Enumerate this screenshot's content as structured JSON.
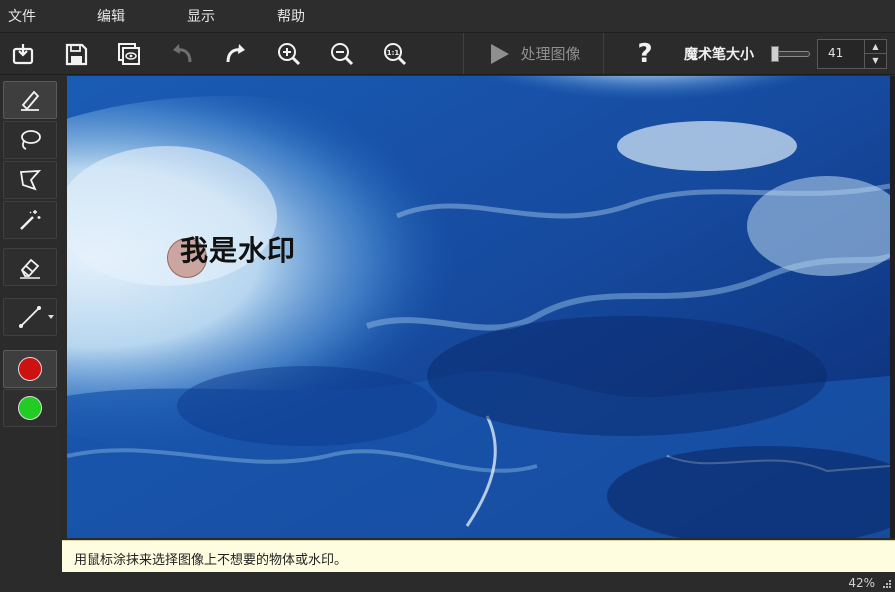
{
  "menu": {
    "file": "文件",
    "edit": "编辑",
    "view": "显示",
    "help": "帮助"
  },
  "toolbar": {
    "open_icon": "open-file-icon",
    "save_icon": "save-icon",
    "preview_icon": "preview-icon",
    "undo_icon": "undo-icon",
    "redo_icon": "redo-icon",
    "zoom_in_icon": "zoom-in-icon",
    "zoom_out_icon": "zoom-out-icon",
    "zoom_actual_icon": "zoom-1to1-icon",
    "zoom_actual_label": "1:1",
    "process_label": "处理图像",
    "help_label": "?",
    "brush_size_label": "魔术笔大小",
    "brush_size_value": "41",
    "spin_up": "▲",
    "spin_down": "▼"
  },
  "tools": {
    "marker": "marker-icon",
    "lasso": "lasso-icon",
    "polygon": "polygon-lasso-icon",
    "magic_wand": "magic-wand-icon",
    "eraser": "eraser-icon",
    "line": "line-icon",
    "red_color": "#cc1111",
    "green_color": "#22cc22"
  },
  "canvas": {
    "watermark_text": "我是水印"
  },
  "hint": {
    "text": "用鼠标涂抹来选择图像上不想要的物体或水印。"
  },
  "status": {
    "zoom": "42%"
  },
  "colors": {
    "disabled_gray": "#8f8f8f",
    "water_dark": "#0d2f7a",
    "water_light": "#dceaf7"
  }
}
